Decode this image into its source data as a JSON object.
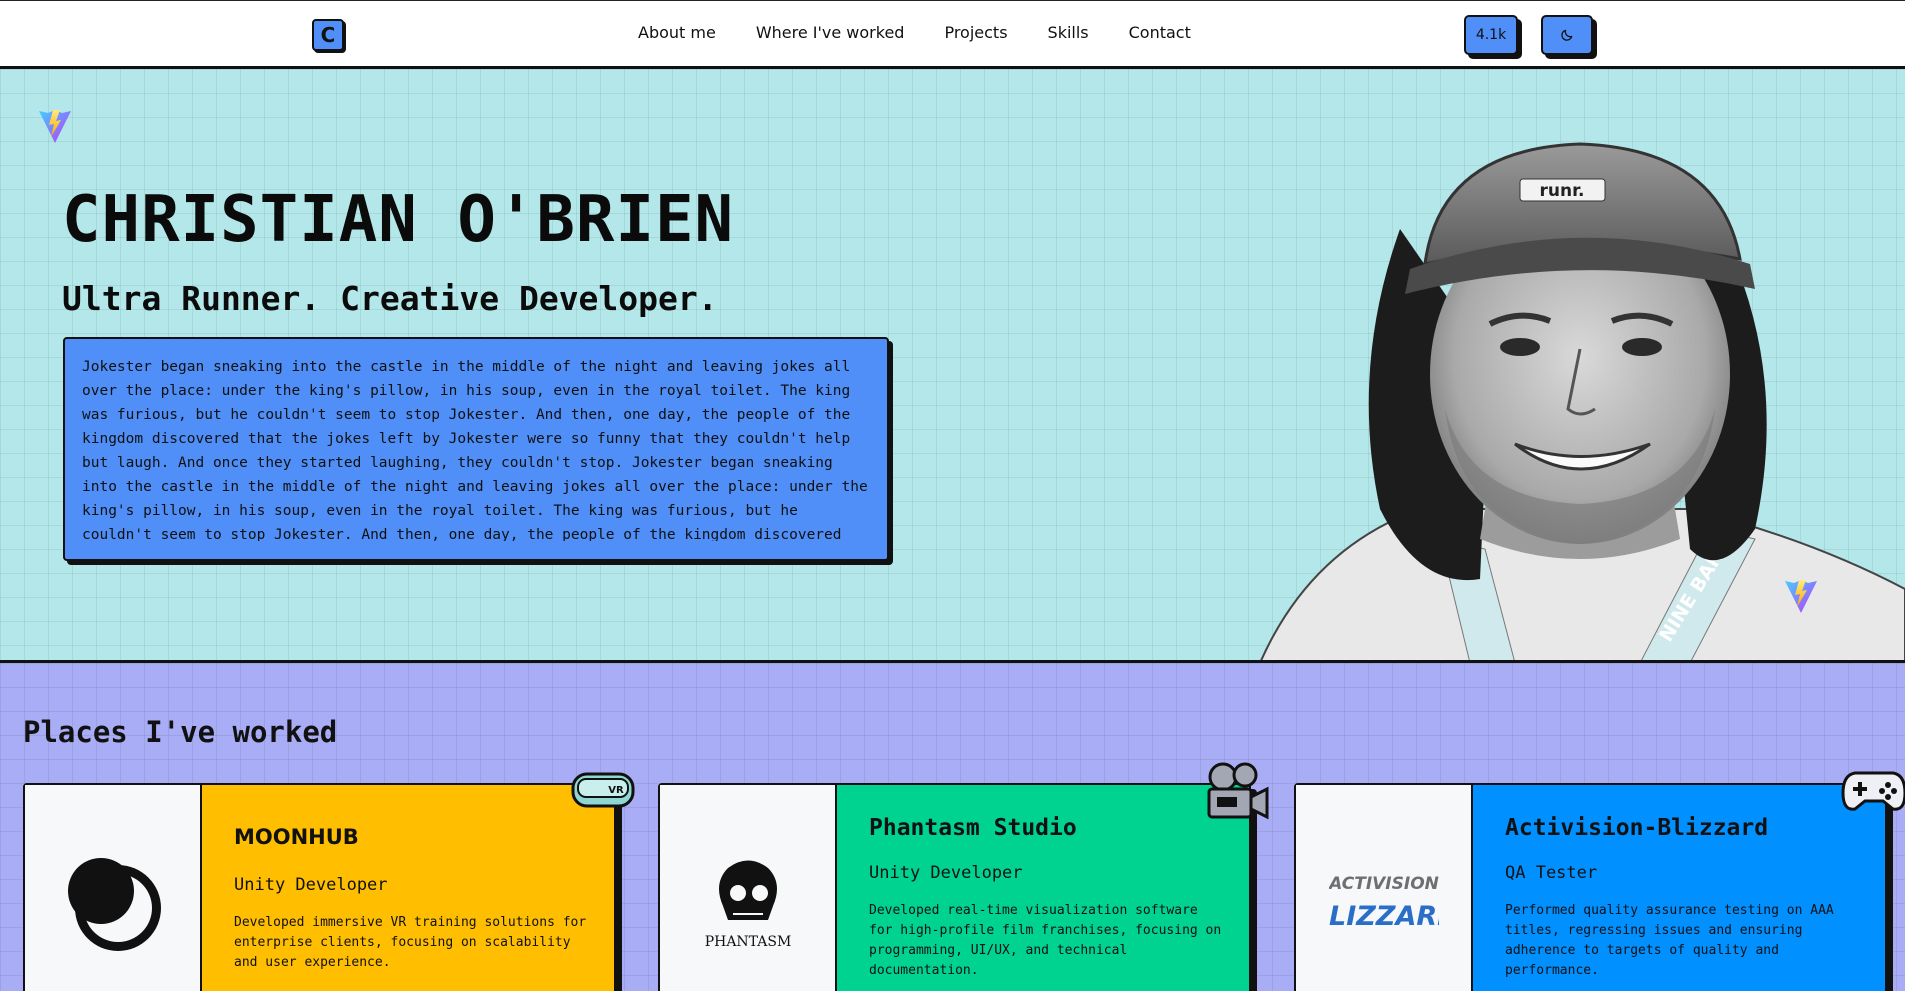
{
  "nav": {
    "logo_letter": "C",
    "links": [
      "About me",
      "Where I've worked",
      "Projects",
      "Skills",
      "Contact"
    ],
    "stars_label": "4.1k",
    "theme_icon": "moon-icon"
  },
  "hero": {
    "name": "CHRISTIAN O'BRIEN",
    "subtitle": "Ultra Runner. Creative Developer.",
    "bio": "Jokester began sneaking into the castle in the middle of the night and leaving jokes all over the place: under the king's pillow, in his soup, even in the royal toilet. The king was furious, but he couldn't seem to stop Jokester. And then, one day, the people of the kingdom discovered that the jokes left by Jokester were so funny that they couldn't help but laugh. And once they started laughing, they couldn't stop. Jokester began sneaking into the castle in the middle of the night and leaving jokes all over the place: under the king's pillow, in his soup, even in the royal toilet. The king was furious, but he couldn't seem to stop Jokester. And then, one day, the people of the kingdom discovered",
    "cap_text": "runr.",
    "lanyard_text": "NINE BAR"
  },
  "places": {
    "title": "Places I've worked",
    "cards": [
      {
        "company": "MOONHUB",
        "role": "Unity Developer",
        "description": "Developed immersive VR training solutions for enterprise clients, focusing on scalability and user experience.",
        "color": "#ffbf00",
        "logo": "moonhub-logo",
        "badge": "vr-headset-icon",
        "badge_text": "VR"
      },
      {
        "company": "Phantasm Studio",
        "role": "Unity Developer",
        "description": "Developed real-time visualization software for high-profile film franchises, focusing on programming, UI/UX, and technical documentation.",
        "color": "#00d390",
        "logo": "phantasm-logo",
        "logo_text": "PHANTASM",
        "badge": "film-camera-icon"
      },
      {
        "company": "Activision-Blizzard",
        "role": "QA Tester",
        "description": "Performed quality assurance testing on AAA titles, regressing issues and ensuring adherence to targets of quality and performance.",
        "color": "#0090ff",
        "logo": "activision-blizzard-logo",
        "logo_text_top": "ACTIVISION",
        "logo_text_bottom": "BLIZZARD",
        "badge": "gamepad-icon"
      }
    ]
  }
}
